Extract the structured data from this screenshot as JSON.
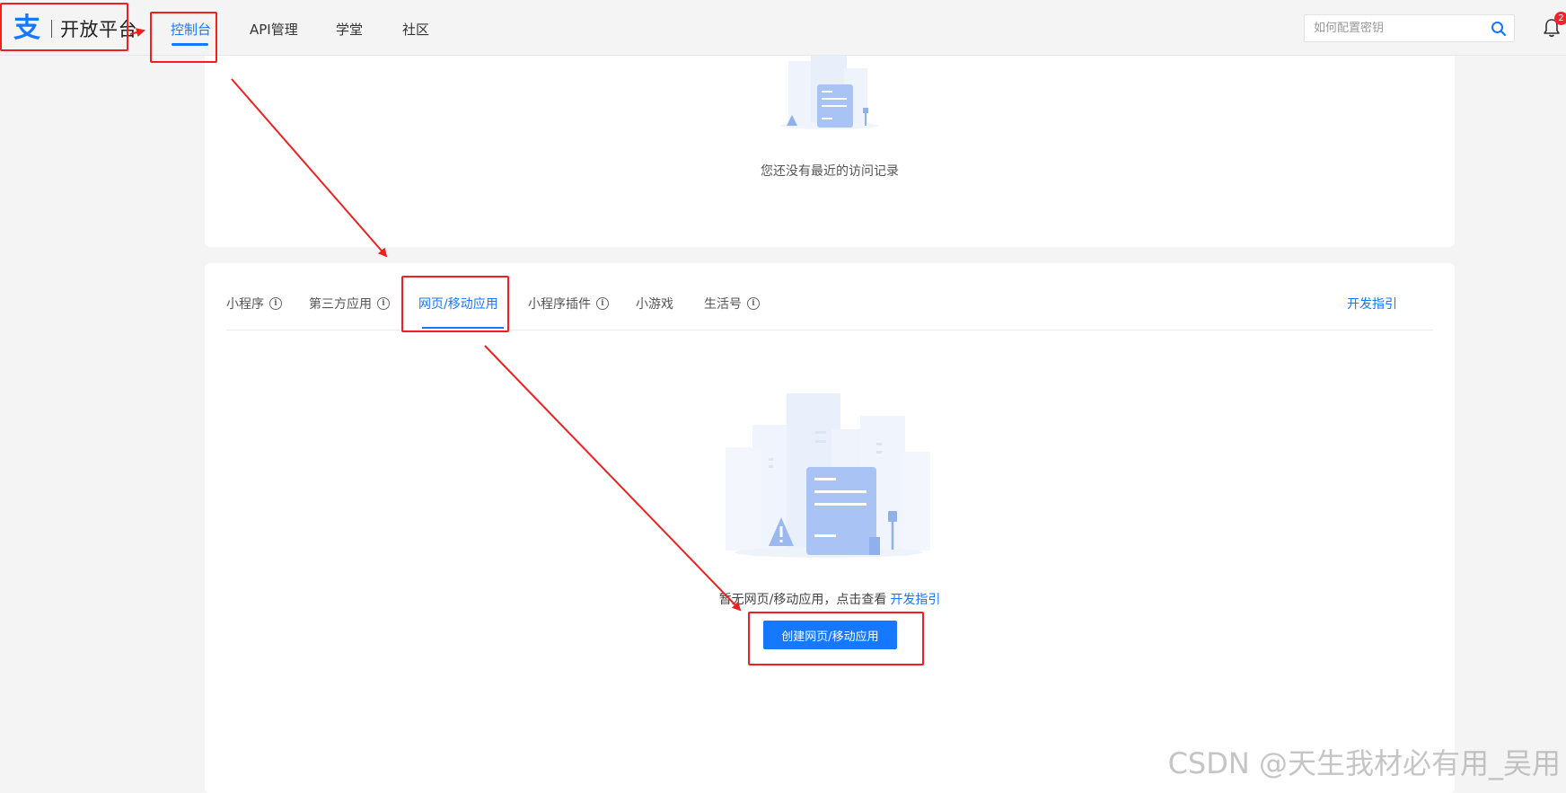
{
  "header": {
    "logo_glyph": "支",
    "logo_text": "开放平台",
    "nav": [
      {
        "label": "控制台",
        "active": true
      },
      {
        "label": "API管理",
        "active": false
      },
      {
        "label": "学堂",
        "active": false
      },
      {
        "label": "社区",
        "active": false
      }
    ],
    "search": {
      "placeholder": "如何配置密钥",
      "value": ""
    },
    "notifications": {
      "count": "2"
    }
  },
  "recent_card": {
    "empty_text": "您还没有最近的访问记录"
  },
  "apps_card": {
    "tabs": [
      {
        "label": "小程序",
        "info": true,
        "active": false
      },
      {
        "label": "第三方应用",
        "info": true,
        "active": false
      },
      {
        "label": "网页/移动应用",
        "info": false,
        "active": true
      },
      {
        "label": "小程序插件",
        "info": true,
        "active": false
      },
      {
        "label": "小游戏",
        "info": false,
        "active": false
      },
      {
        "label": "生活号",
        "info": true,
        "active": false
      }
    ],
    "dev_guide_link": "开发指引",
    "empty_text": "暂无网页/移动应用，点击查看",
    "empty_link": "开发指引",
    "create_button": "创建网页/移动应用"
  },
  "watermark": "CSDN @天生我材必有用_吴用",
  "colors": {
    "accent": "#1677ff",
    "annotation": "#f02020",
    "badge": "#f5222d",
    "page_bg": "#f4f4f5"
  },
  "icons": [
    "alipay-logo-icon",
    "search-icon",
    "bell-icon",
    "info-icon",
    "empty-state-illustration"
  ]
}
